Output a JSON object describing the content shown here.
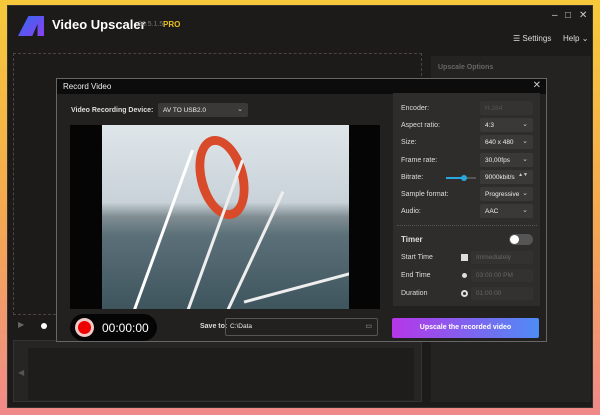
{
  "app": {
    "title": "Video Upscaler",
    "version": "26.5.1.5",
    "badge": "PRO",
    "settings": "Settings",
    "help": "Help",
    "minimize": "–",
    "maximize": "□",
    "close": "✕"
  },
  "background": {
    "upscale_options": "Upscale Options"
  },
  "dialog": {
    "title": "Record Video",
    "close": "✕",
    "device_label": "Video Recording Device:",
    "device_value": "AV TO USB2.0",
    "settings": [
      {
        "label": "Encoder:",
        "value": "H.264",
        "disabled": true
      },
      {
        "label": "Aspect ratio:",
        "value": "4:3"
      },
      {
        "label": "Size:",
        "value": "640 x 480"
      },
      {
        "label": "Frame rate:",
        "value": "30,00fps"
      },
      {
        "label": "Bitrate:",
        "value": "9000kbit/s"
      },
      {
        "label": "Sample format:",
        "value": "Progressive"
      },
      {
        "label": "Audio:",
        "value": "AAC"
      }
    ],
    "bitrate_slider": 0.6,
    "timer": {
      "label": "Timer",
      "enabled": false,
      "start_label": "Start Time",
      "start_value": "Immediately",
      "end_label": "End Time",
      "end_value": "03:00:00 PM",
      "duration_label": "Duration",
      "duration_value": "01:00:00"
    },
    "record_time": "00:00:00",
    "save_label": "Save to:",
    "save_value": "C:\\Data",
    "upscale_button": "Upscale the recorded video"
  }
}
